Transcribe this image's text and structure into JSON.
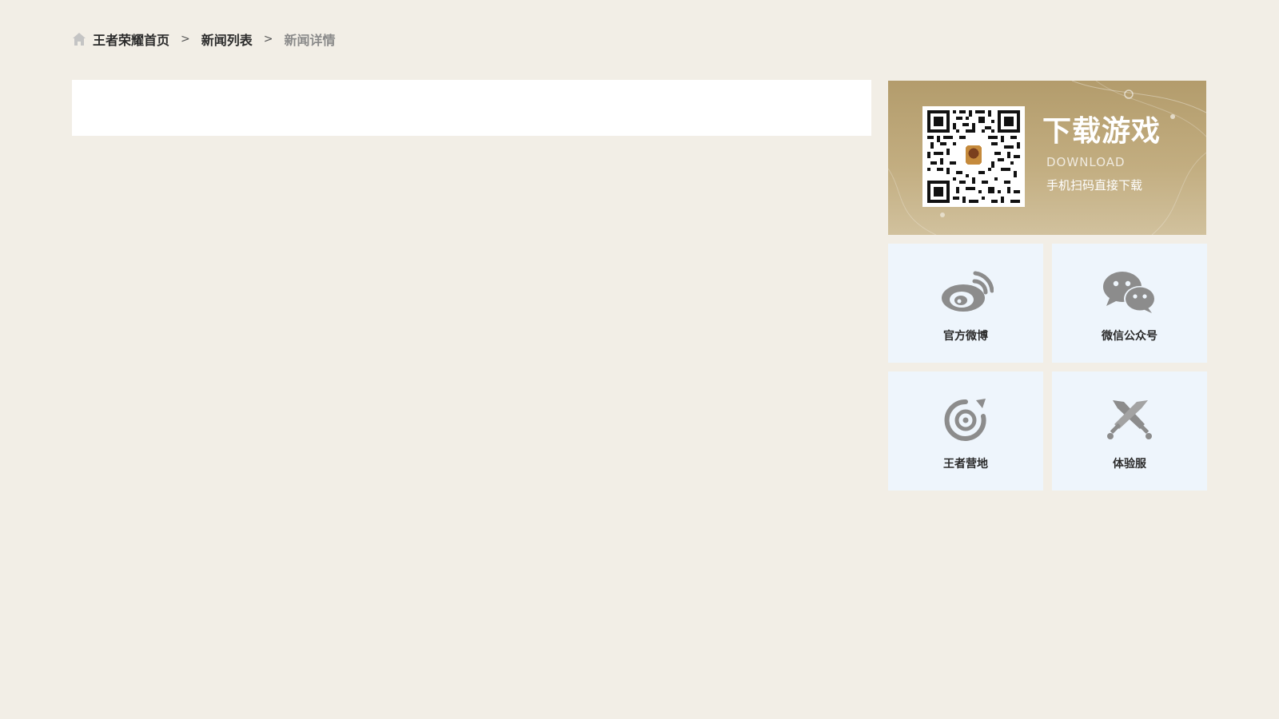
{
  "breadcrumb": {
    "home": "王者荣耀首页",
    "list": "新闻列表",
    "current": "新闻详情",
    "separator": ">",
    "home_icon": "home-icon"
  },
  "download": {
    "title": "下载游戏",
    "subtitle": "DOWNLOAD",
    "description": "手机扫码直接下载",
    "qr_icon": "qr-code"
  },
  "tiles": [
    {
      "label": "官方微博",
      "icon": "weibo-icon"
    },
    {
      "label": "微信公众号",
      "icon": "wechat-icon"
    },
    {
      "label": "王者营地",
      "icon": "camp-icon"
    },
    {
      "label": "体验服",
      "icon": "crossed-swords-icon"
    }
  ],
  "colors": {
    "page_bg": "#f2eee6",
    "banner_gold": "#b39c6c",
    "tile_bg": "#eef5fc",
    "icon_gray": "#8c8c8c"
  }
}
